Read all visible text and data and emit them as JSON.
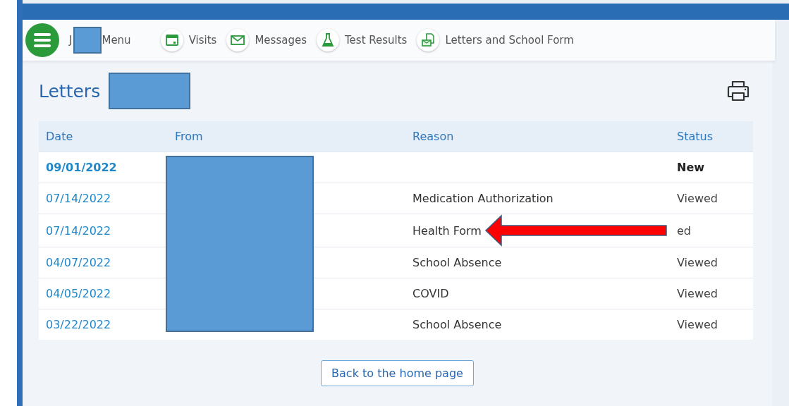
{
  "nav": {
    "menu_initial": "J",
    "menu_label": "Menu",
    "items": [
      {
        "label": "Visits"
      },
      {
        "label": "Messages"
      },
      {
        "label": "Test Results"
      },
      {
        "label": "Letters and School Form"
      }
    ]
  },
  "page": {
    "title": "Letters"
  },
  "table": {
    "columns": [
      "Date",
      "From",
      "Reason",
      "Status"
    ],
    "rows": [
      {
        "date": "09/01/2022",
        "status": "New",
        "unread": true
      },
      {
        "date": "07/14/2022",
        "reason": "Medication Authorization",
        "status": "Viewed",
        "unread": false
      },
      {
        "date": "07/14/2022",
        "reason": "Health Form",
        "status": "ed",
        "unread": false,
        "arrow": true
      },
      {
        "date": "04/07/2022",
        "reason": "School Absence",
        "status": "Viewed",
        "unread": false
      },
      {
        "date": "04/05/2022",
        "reason": "COVID",
        "status": "Viewed",
        "unread": false
      },
      {
        "date": "03/22/2022",
        "reason": "School Absence",
        "status": "Viewed",
        "unread": false
      }
    ]
  },
  "back_button": "Back to the home page"
}
